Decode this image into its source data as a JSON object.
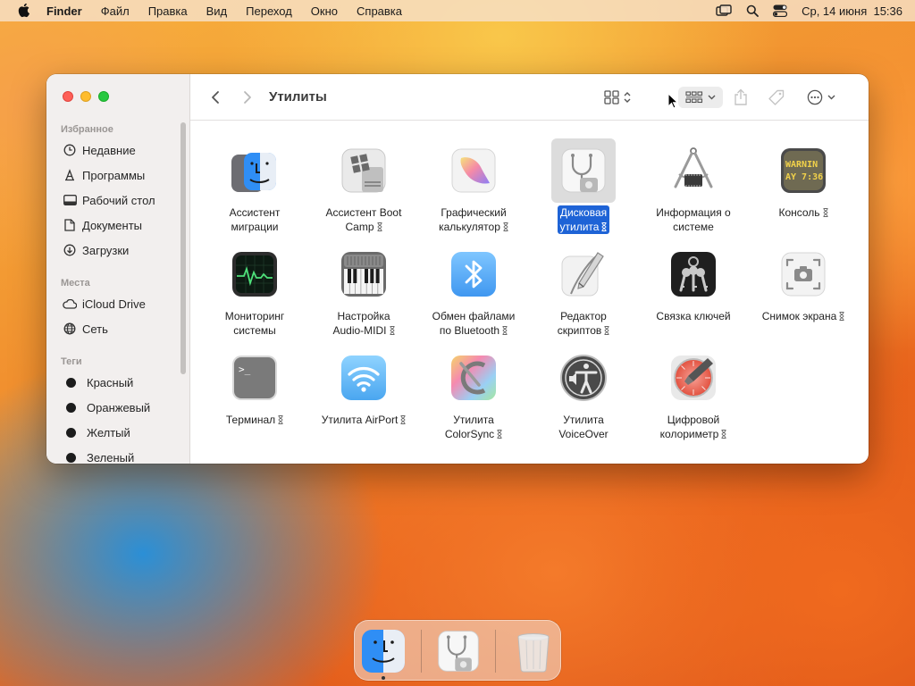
{
  "menubar": {
    "items": [
      "Finder",
      "Файл",
      "Правка",
      "Вид",
      "Переход",
      "Окно",
      "Справка"
    ],
    "clock": "Ср, 14 июня  15:36"
  },
  "sidebar": {
    "favorites_title": "Избранное",
    "favorites": [
      "Недавние",
      "Программы",
      "Рабочий стол",
      "Документы",
      "Загрузки"
    ],
    "places_title": "Места",
    "places": [
      "iCloud Drive",
      "Сеть"
    ],
    "tags_title": "Теги",
    "tags": [
      "Красный",
      "Оранжевый",
      "Желтый",
      "Зеленый"
    ]
  },
  "toolbar": {
    "title": "Утилиты"
  },
  "items": [
    {
      "name": "Ассистент миграции",
      "l1": "Ассистент",
      "l2": "миграции",
      "icon": "migration-assistant-icon"
    },
    {
      "name": "Ассистент Boot Camp",
      "l1": "Ассистент Boot",
      "l2": "Camp",
      "icon": "boot-camp-icon",
      "badge": true
    },
    {
      "name": "Графический калькулятор",
      "l1": "Графический",
      "l2": "калькулятор",
      "icon": "grapher-icon",
      "badge": true
    },
    {
      "name": "Дисковая утилита",
      "l1": "Дисковая",
      "l2": "утилита",
      "icon": "disk-utility-icon",
      "badge": true,
      "selected": true
    },
    {
      "name": "Информация о системе",
      "l1": "Информация о",
      "l2": "системе",
      "icon": "system-information-icon"
    },
    {
      "name": "Консоль",
      "l1": "Консоль",
      "l2": "",
      "icon": "console-icon",
      "badge": true
    },
    {
      "name": "Мониторинг системы",
      "l1": "Мониторинг",
      "l2": "системы",
      "icon": "activity-monitor-icon"
    },
    {
      "name": "Настройка Audio-MIDI",
      "l1": "Настройка",
      "l2": "Audio-MIDI",
      "icon": "audio-midi-icon",
      "badge": true
    },
    {
      "name": "Обмен файлами по Bluetooth",
      "l1": "Обмен файлами",
      "l2": "по Bluetooth",
      "icon": "bluetooth-exchange-icon",
      "badge": true
    },
    {
      "name": "Редактор скриптов",
      "l1": "Редактор",
      "l2": "скриптов",
      "icon": "script-editor-icon",
      "badge": true
    },
    {
      "name": "Связка ключей",
      "l1": "Связка ключей",
      "l2": "",
      "icon": "keychain-icon"
    },
    {
      "name": "Снимок экрана",
      "l1": "Снимок экрана",
      "l2": "",
      "icon": "screenshot-icon",
      "badge": true
    },
    {
      "name": "Терминал",
      "l1": "Терминал",
      "l2": "",
      "icon": "terminal-icon",
      "badge": true
    },
    {
      "name": "Утилита AirPort",
      "l1": "Утилита AirPort",
      "l2": "",
      "icon": "airport-utility-icon",
      "badge": true
    },
    {
      "name": "Утилита ColorSync",
      "l1": "Утилита",
      "l2": "ColorSync",
      "icon": "colorsync-icon",
      "badge": true
    },
    {
      "name": "Утилита VoiceOver",
      "l1": "Утилита",
      "l2": "VoiceOver",
      "icon": "voiceover-icon"
    },
    {
      "name": "Цифровой колориметр",
      "l1": "Цифровой",
      "l2": "колориметр",
      "icon": "digital-color-meter-icon",
      "badge": true
    }
  ],
  "icon_text": {
    "console_line1": "WARNIN",
    "console_line2": "AY 7:36",
    "terminal_prompt": ">_"
  },
  "dock": [
    "Finder",
    "Дисковая утилита",
    "Корзина"
  ],
  "colors": {
    "selection": "#1e63d6",
    "close": "#fe5f57",
    "minimize": "#febc2e",
    "zoom": "#28c840"
  }
}
